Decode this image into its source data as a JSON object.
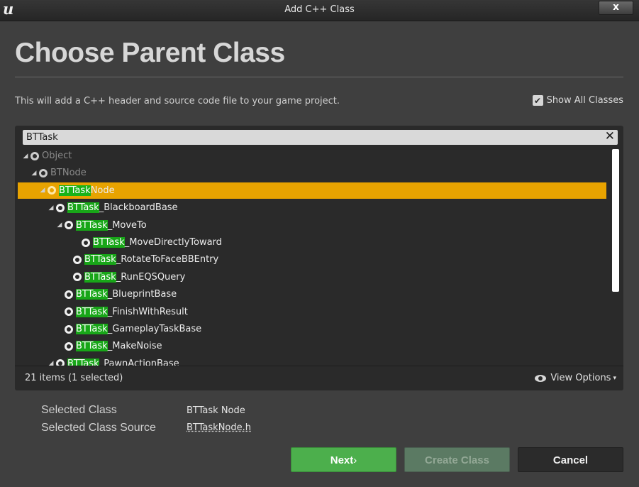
{
  "window": {
    "title": "Add C++ Class",
    "close_label": "x",
    "logo": "u"
  },
  "header": {
    "heading": "Choose Parent Class",
    "description": "This will add a C++ header and source code file to your game project.",
    "show_all_label": "Show All Classes",
    "show_all_checked": true
  },
  "search": {
    "value": "BTTask",
    "clear_label": "✕"
  },
  "tree": {
    "highlight_color": "#18a618",
    "selected_color": "#e8a300",
    "rows": [
      {
        "match": "",
        "rest": "Object",
        "expander": "◢",
        "dim": true,
        "selected": false
      },
      {
        "match": "",
        "rest": "BTNode",
        "expander": "◢",
        "dim": true,
        "selected": false
      },
      {
        "match": "BTTask",
        "rest": "Node",
        "expander": "◢",
        "dim": false,
        "selected": true
      },
      {
        "match": "BTTask",
        "rest": "_BlackboardBase",
        "expander": "◢",
        "dim": false,
        "selected": false
      },
      {
        "match": "BTTask",
        "rest": "_MoveTo",
        "expander": "◢",
        "dim": false,
        "selected": false
      },
      {
        "match": "BTTask",
        "rest": "_MoveDirectlyToward",
        "expander": "",
        "dim": false,
        "selected": false
      },
      {
        "match": "BTTask",
        "rest": "_RotateToFaceBBEntry",
        "expander": "",
        "dim": false,
        "selected": false
      },
      {
        "match": "BTTask",
        "rest": "_RunEQSQuery",
        "expander": "",
        "dim": false,
        "selected": false
      },
      {
        "match": "BTTask",
        "rest": "_BlueprintBase",
        "expander": "",
        "dim": false,
        "selected": false
      },
      {
        "match": "BTTask",
        "rest": "_FinishWithResult",
        "expander": "",
        "dim": false,
        "selected": false
      },
      {
        "match": "BTTask",
        "rest": "_GameplayTaskBase",
        "expander": "",
        "dim": false,
        "selected": false
      },
      {
        "match": "BTTask",
        "rest": "_MakeNoise",
        "expander": "",
        "dim": false,
        "selected": false
      },
      {
        "match": "BTTask",
        "rest": "_PawnActionBase",
        "expander": "◢",
        "dim": false,
        "selected": false
      }
    ]
  },
  "footer": {
    "count_text": "21 items (1 selected)",
    "view_options_label": "View Options",
    "chevron": "▾"
  },
  "selection": {
    "class_label": "Selected Class",
    "class_value": "BTTask Node",
    "source_label": "Selected Class Source",
    "source_value": "BTTaskNode.h"
  },
  "buttons": {
    "next": "Next",
    "next_arrow": "›",
    "create": "Create Class",
    "cancel": "Cancel"
  }
}
